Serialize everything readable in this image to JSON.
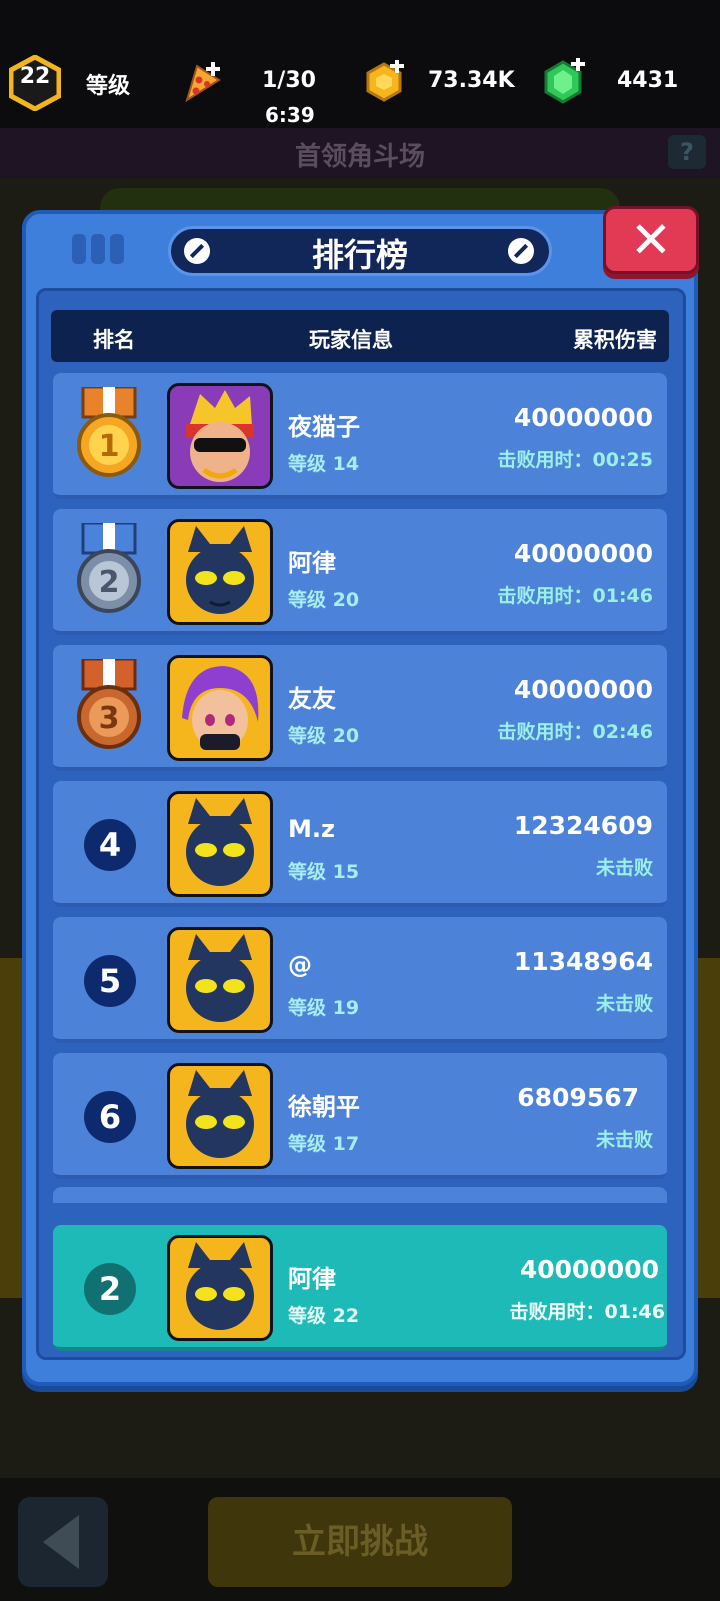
{
  "hud": {
    "player_level": "22",
    "level_label": "等级",
    "energy": "1/30",
    "energy_timer": "6:39",
    "coins": "73.34K",
    "gems": "4431",
    "icons": [
      "level-hex-icon",
      "pizza-energy-icon",
      "gold-coin-icon",
      "green-gem-icon"
    ]
  },
  "background": {
    "title": "首领角斗场",
    "help_label": "?",
    "challenge_button": "立即挑战"
  },
  "panel": {
    "title": "排行榜",
    "close_label": "✕",
    "columns": [
      "排名",
      "玩家信息",
      "累积伤害"
    ]
  },
  "rows": [
    {
      "rank": "1",
      "name": "夜猫子",
      "level": "等级 14",
      "score": "40000000",
      "status": "击败用时：00:25",
      "avatar": "purple"
    },
    {
      "rank": "2",
      "name": "阿律",
      "level": "等级 20",
      "score": "40000000",
      "status": "击败用时：01:46",
      "avatar": "yellow"
    },
    {
      "rank": "3",
      "name": "友友",
      "level": "等级 20",
      "score": "40000000",
      "status": "击败用时：02:46",
      "avatar": "yellow"
    },
    {
      "rank": "4",
      "name": "M.z",
      "level": "等级 15",
      "score": "12324609",
      "status": "未击败",
      "avatar": "yellow"
    },
    {
      "rank": "5",
      "name": "@",
      "level": "等级 19",
      "score": "11348964",
      "status": "未击败",
      "avatar": "yellow"
    },
    {
      "rank": "6",
      "name": "徐朝平",
      "level": "等级 17",
      "score": "6809567",
      "status": "未击败",
      "avatar": "yellow"
    }
  ],
  "me": {
    "rank": "2",
    "name": "阿律",
    "level": "等级 22",
    "score": "40000000",
    "status": "击败用时：01:46"
  },
  "colors": {
    "gold": "#f5a623",
    "silver": "#7d8fa8",
    "bronze": "#c8682f",
    "self_row": "#1dbab8"
  }
}
